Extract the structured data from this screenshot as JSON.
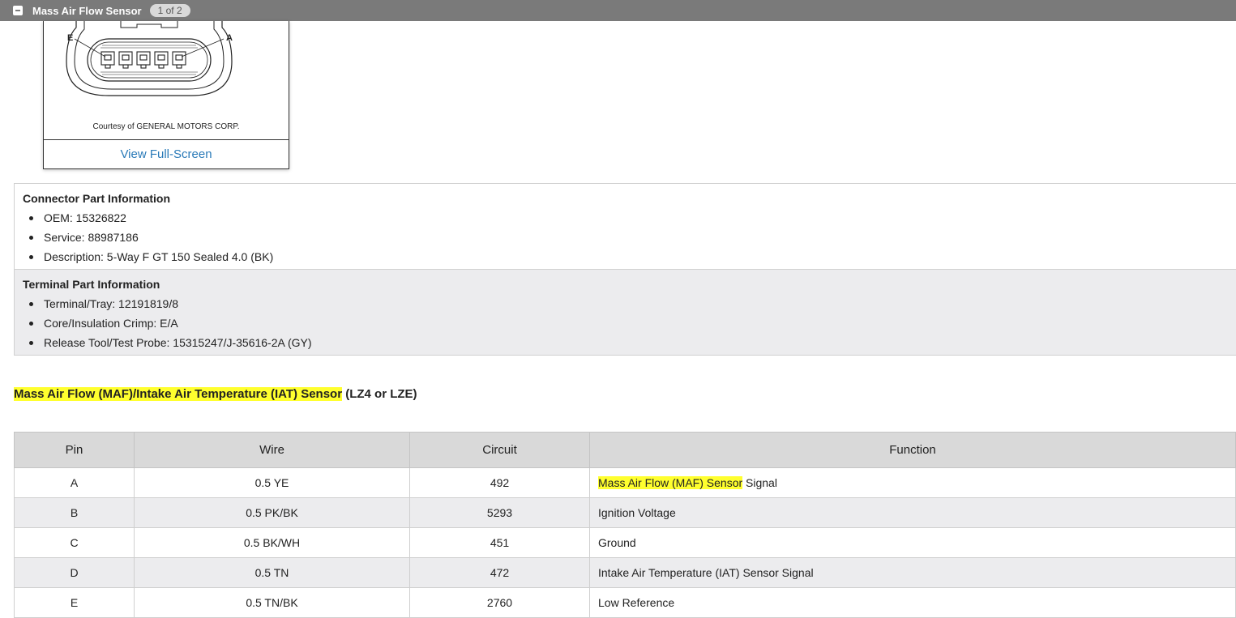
{
  "header": {
    "title": "Mass Air Flow Sensor",
    "page_badge": "1 of 2"
  },
  "figure": {
    "terminal_label_left": "E",
    "terminal_label_right": "A",
    "courtesy": "Courtesy of GENERAL MOTORS CORP.",
    "fullscreen_link": "View Full-Screen"
  },
  "connector_info": {
    "heading": "Connector Part Information",
    "items": [
      "OEM: 15326822",
      "Service: 88987186",
      "Description: 5-Way F GT 150 Sealed 4.0 (BK)"
    ]
  },
  "terminal_info": {
    "heading": "Terminal Part Information",
    "items": [
      "Terminal/Tray: 12191819/8",
      "Core/Insulation Crimp: E/A",
      "Release Tool/Test Probe: 15315247/J-35616-2A (GY)"
    ]
  },
  "section": {
    "title_highlight": "Mass Air Flow (MAF)/Intake Air Temperature (IAT) Sensor",
    "title_rest": " (LZ4 or LZE)"
  },
  "table": {
    "headers": [
      "Pin",
      "Wire",
      "Circuit",
      "Function"
    ],
    "rows": [
      {
        "pin": "A",
        "wire": "0.5 YE",
        "circuit": "492",
        "function_highlight": "Mass Air Flow (MAF) Sensor",
        "function": " Signal"
      },
      {
        "pin": "B",
        "wire": "0.5 PK/BK",
        "circuit": "5293",
        "function_highlight": "",
        "function": "Ignition Voltage"
      },
      {
        "pin": "C",
        "wire": "0.5 BK/WH",
        "circuit": "451",
        "function_highlight": "",
        "function": "Ground"
      },
      {
        "pin": "D",
        "wire": "0.5 TN",
        "circuit": "472",
        "function_highlight": "",
        "function": "Intake Air Temperature (IAT) Sensor Signal"
      },
      {
        "pin": "E",
        "wire": "0.5 TN/BK",
        "circuit": "2760",
        "function_highlight": "",
        "function": "Low Reference"
      }
    ]
  },
  "colors": {
    "header_bar": "#7a7a7a",
    "highlight": "#ffff2e",
    "link": "#2a7ab8",
    "table_header_bg": "#d9d9d9",
    "alt_row_bg": "#ececee"
  }
}
